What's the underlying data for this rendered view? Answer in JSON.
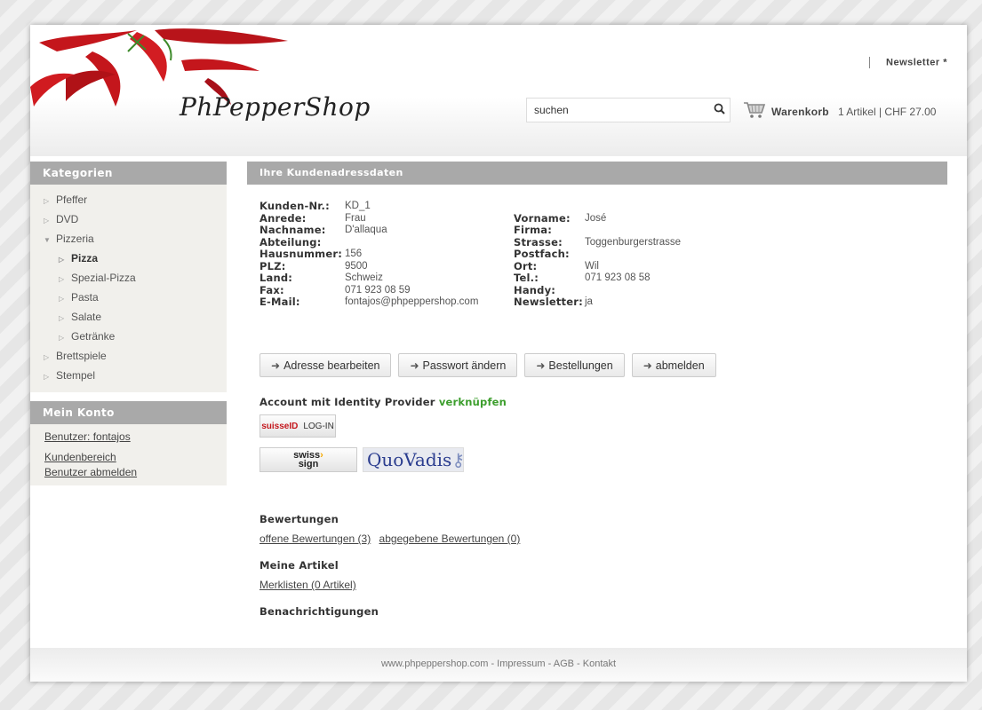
{
  "header": {
    "logo": "PhPepperShop",
    "newsletter": "Newsletter *",
    "search_value": "suchen",
    "cart_label": "Warenkorb",
    "cart_info": "1 Artikel | CHF 27.00"
  },
  "sidebar": {
    "categories_title": "Kategorien",
    "categories": [
      {
        "label": "Pfeffer",
        "level": 0,
        "expanded": false
      },
      {
        "label": "DVD",
        "level": 0,
        "expanded": false
      },
      {
        "label": "Pizzeria",
        "level": 0,
        "expanded": true
      },
      {
        "label": "Pizza",
        "level": 1,
        "active": true
      },
      {
        "label": "Spezial-Pizza",
        "level": 1
      },
      {
        "label": "Pasta",
        "level": 1
      },
      {
        "label": "Salate",
        "level": 1
      },
      {
        "label": "Getränke",
        "level": 1
      },
      {
        "label": "Brettspiele",
        "level": 0,
        "expanded": false
      },
      {
        "label": "Stempel",
        "level": 0,
        "expanded": false
      }
    ],
    "account_title": "Mein Konto",
    "account_user": "Benutzer: fontajos",
    "account_area": "Kundenbereich",
    "account_logout": "Benutzer abmelden"
  },
  "main": {
    "title": "Ihre Kundenadressdaten",
    "left_fields": [
      {
        "k": "Kunden-Nr.:",
        "v": "KD_1"
      },
      {
        "k": "Anrede:",
        "v": "Frau"
      },
      {
        "k": "Nachname:",
        "v": "D'allaqua"
      },
      {
        "k": "Abteilung:",
        "v": ""
      },
      {
        "k": "Hausnummer:",
        "v": "156"
      },
      {
        "k": "PLZ:",
        "v": "9500"
      },
      {
        "k": "Land:",
        "v": "Schweiz"
      },
      {
        "k": "Fax:",
        "v": "071 923 08 59"
      },
      {
        "k": "E-Mail:",
        "v": "fontajos@phpeppershop.com"
      }
    ],
    "right_fields": [
      {
        "k": "Vorname:",
        "v": "José"
      },
      {
        "k": "Firma:",
        "v": ""
      },
      {
        "k": "Strasse:",
        "v": "Toggenburgerstrasse"
      },
      {
        "k": "Postfach:",
        "v": ""
      },
      {
        "k": "Ort:",
        "v": "Wil"
      },
      {
        "k": "Tel.:",
        "v": "071 923 08 58"
      },
      {
        "k": "Handy:",
        "v": ""
      },
      {
        "k": "Newsletter:",
        "v": "ja"
      }
    ],
    "buttons": {
      "edit_address": "Adresse bearbeiten",
      "change_password": "Passwort ändern",
      "orders": "Bestellungen",
      "logout": "abmelden"
    },
    "idp": {
      "title": "Account mit Identity Provider",
      "link": "verknüpfen",
      "suisseid_brand": "suisseID",
      "suisseid_login": "LOG-IN",
      "swisssign_top": "swiss",
      "swisssign_bottom": "sign",
      "quovadis": "QuoVadis"
    },
    "ratings": {
      "title": "Bewertungen",
      "open": "offene Bewertungen (3)",
      "given": "abgegebene Bewertungen (0)"
    },
    "articles": {
      "title": "Meine Artikel",
      "watchlist": "Merklisten (0 Artikel)"
    },
    "notifications": {
      "title": "Benachrichtigungen"
    }
  },
  "footer": {
    "text": "www.phpeppershop.com - Impressum - AGB - Kontakt"
  }
}
